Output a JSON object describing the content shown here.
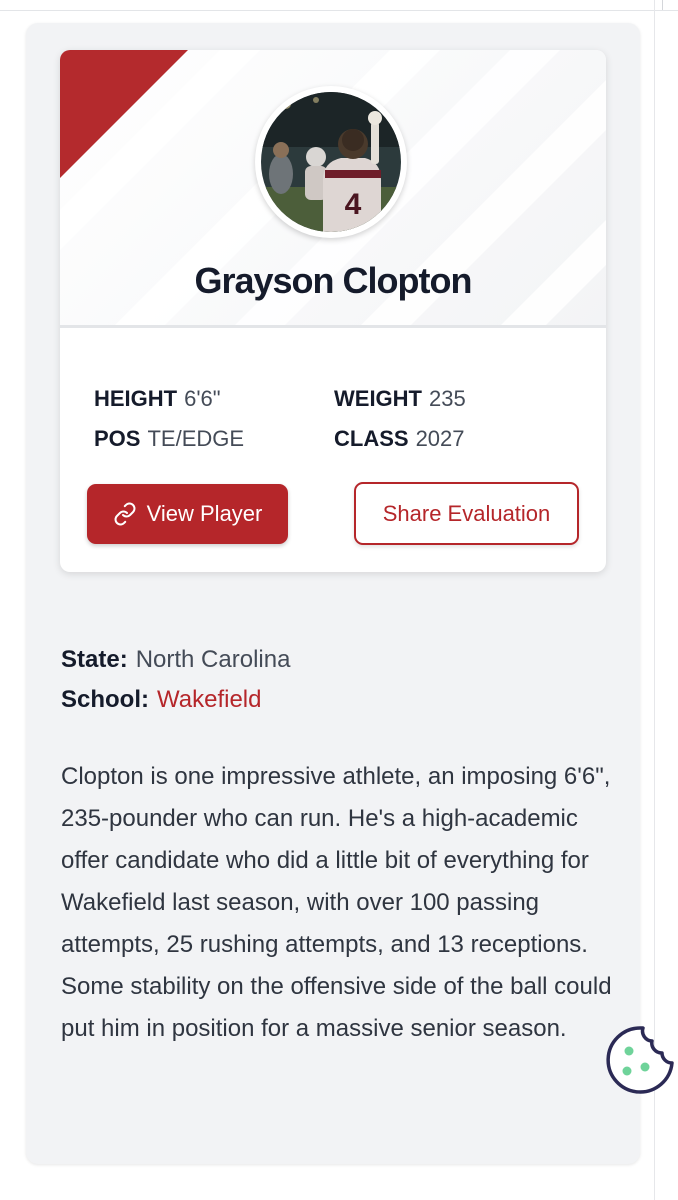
{
  "player": {
    "name": "Grayson Clopton",
    "jersey_number": "4",
    "stats": {
      "height_label": "HEIGHT",
      "height_value": "6'6\"",
      "weight_label": "WEIGHT",
      "weight_value": "235",
      "pos_label": "POS",
      "pos_value": "TE/EDGE",
      "class_label": "CLASS",
      "class_value": "2027"
    }
  },
  "actions": {
    "view_player_label": "View Player",
    "share_label": "Share Evaluation"
  },
  "info": {
    "state_label": "State:",
    "state_value": "North Carolina",
    "school_label": "School:",
    "school_value": "Wakefield"
  },
  "description": "Clopton is one impressive athlete, an imposing 6'6\", 235-pounder who can run. He's a high-academic offer candidate who did a little bit of everything for Wakefield last season, with over 100 passing attempts, 25 rushing attempts, and 13 receptions. Some stability on the offensive side of the ball could put him in position for a massive senior season.",
  "colors": {
    "brand_red": "#b5262a",
    "text_dark": "#151b2b",
    "text_muted": "#444b57",
    "card_bg": "#f2f3f5"
  },
  "icons": {
    "view_player": "link-icon",
    "cookie": "cookie-icon"
  }
}
